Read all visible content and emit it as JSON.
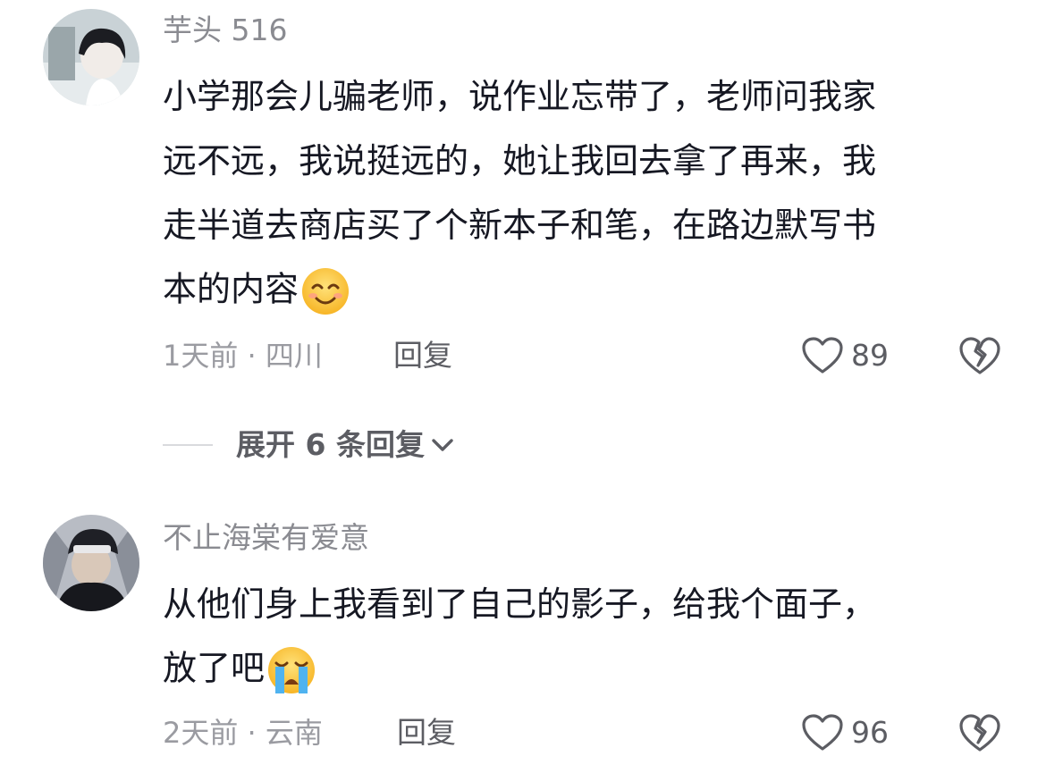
{
  "comments": [
    {
      "username": "芋头 516",
      "text_lines": [
        "小学那会儿骗老师，说作业忘带了，老师问我家",
        "远不远，我说挺远的，她让我回去拿了再来，我",
        "走半道去商店买了个新本子和笔，在路边默写书",
        "本的内容"
      ],
      "emoji": "smiling-face-emoji",
      "time_location": "1天前 · 四川",
      "reply_label": "回复",
      "likes": "89"
    },
    {
      "username": "不止海棠有爱意",
      "text_lines": [
        "从他们身上我看到了自己的影子，给我个面子，",
        "放了吧"
      ],
      "emoji": "loudly-crying-face-emoji",
      "time_location": "2天前 · 云南",
      "reply_label": "回复",
      "likes": "96"
    }
  ],
  "expand_replies": {
    "label": "展开 6 条回复"
  },
  "colors": {
    "text": "#161823",
    "muted": "#9a9ba1",
    "secondary": "#5c5d63",
    "divider": "#d9dadd"
  }
}
